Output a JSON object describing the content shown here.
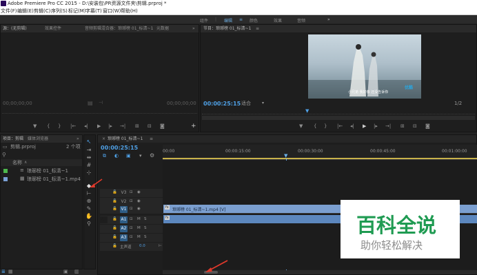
{
  "app": {
    "title": "Adobe Premiere Pro CC 2015 - D:\\安装包\\PR资源文件夹\\剪辑.prproj *"
  },
  "menu": [
    "文件(F)",
    "编辑(E)",
    "剪辑(C)",
    "序列(S)",
    "标记(M)",
    "字幕(T)",
    "窗口(W)",
    "帮助(H)"
  ],
  "workspaces": [
    "组件",
    "编辑",
    "颜色",
    "效果",
    "音频"
  ],
  "workspace_more": "»",
  "source_panel": {
    "tabs": [
      "源：(无剪辑)",
      "效果控件",
      "音频剪辑混合器：琅琊榜 01_标清~1",
      "元数据"
    ],
    "more": "»",
    "timecode_left": "00;00;00;00",
    "timecode_right": "00;00;00;00"
  },
  "program_panel": {
    "tab": "节目：琅琊榜 01_标清~1",
    "menu": "≡",
    "timecode": "00:00:25:15",
    "fit": "适合",
    "ratio": "1/2",
    "subtitle": "小兄弟 我好像 还没告诉你",
    "logo": "优酷"
  },
  "project_panel": {
    "tabs": [
      "项目：剪辑",
      "媒体浏览器"
    ],
    "more": "»",
    "file": "剪辑.prproj",
    "count": "2 个项",
    "col_name": "名称",
    "items": [
      "琅琊榜 01_标清~1",
      "琅琊榜 01_标清~1.mp4"
    ],
    "item_colors": [
      "#4db84d",
      "#7aa0d6"
    ]
  },
  "timeline": {
    "tab": "琅琊榜 01_标清~1",
    "close": "×",
    "menu": "≡",
    "timecode": "00:00:25:15",
    "ruler": [
      "00:00",
      "00:00:15:00",
      "00:00:30:00",
      "00:00:45:00",
      "00:01:00:00"
    ],
    "video_tracks": [
      "V3",
      "V2",
      "V1"
    ],
    "audio_tracks": [
      "A1",
      "A2",
      "A3"
    ],
    "master_label": "主声道",
    "master_value": "0.0",
    "video_clip": "琅琊榜 01_标清~1.mp4 [V]",
    "audio_clip": "",
    "mute": "M",
    "solo": "S",
    "fx": "fx"
  },
  "watermark": {
    "title": "百科全说",
    "subtitle": "助你轻松解决"
  },
  "colors": {
    "accent": "#4fa0e5",
    "clip_video": "#7b9fd0",
    "clip_audio": "#5c87be",
    "playhead": "#6ab0e8",
    "annotation_arrow": "#e0392b",
    "watermark_text": "#1f9b52"
  },
  "icons": {
    "tools": [
      "selection-tool-icon",
      "track-select-icon",
      "ripple-edit-icon",
      "rolling-edit-icon",
      "rate-stretch-icon",
      "razor-icon",
      "slip-icon",
      "slide-icon",
      "pen-icon",
      "hand-icon",
      "zoom-icon"
    ]
  }
}
